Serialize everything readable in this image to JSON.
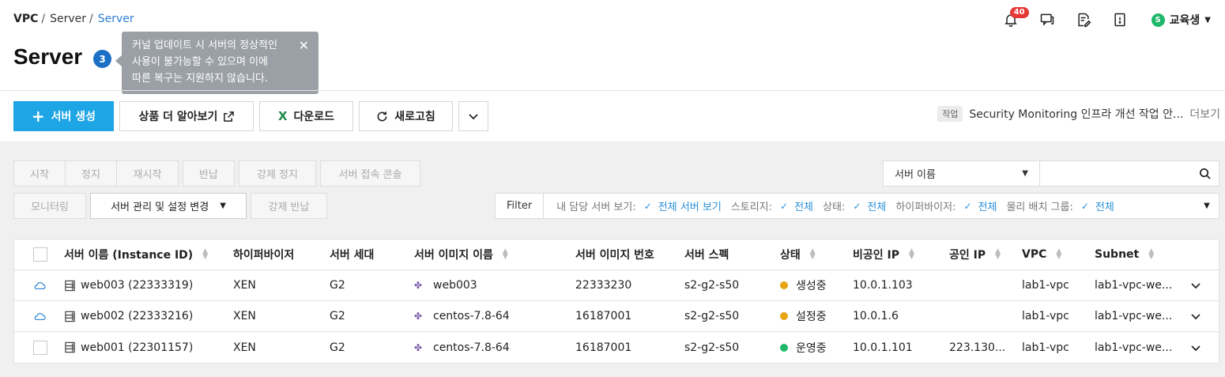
{
  "breadcrumb": {
    "root": "VPC",
    "item": "Server",
    "current": "Server",
    "sep": "/"
  },
  "header": {
    "title": "Server",
    "badge": "3"
  },
  "tooltip": {
    "lines": [
      "커널 업데이트 시 서버의 정상적인",
      "사용이 불가능할 수 있으며 이에",
      "따른 복구는 지원하지 않습니다."
    ],
    "close": "✕"
  },
  "topbar": {
    "notifications": "40",
    "user": "교육생",
    "user_initial": "S"
  },
  "actions": {
    "create": "서버 생성",
    "learn": "상품 더 알아보기",
    "download": "다운로드",
    "refresh": "새로고침"
  },
  "notice": {
    "tag": "작업",
    "text": "Security Monitoring 인프라 개선 작업 안...",
    "more": "더보기"
  },
  "controls": {
    "start": "시작",
    "stop": "정지",
    "restart": "재시작",
    "return": "반납",
    "force_stop": "강제 정지",
    "console": "서버 접속 콘솔",
    "monitoring": "모니터링",
    "manage": "서버 관리 및 설정 변경",
    "force_return": "강제 반납"
  },
  "search": {
    "select": "서버 이름",
    "placeholder": ""
  },
  "filter": {
    "label": "Filter",
    "items": [
      {
        "key": "내 담당 서버 보기:",
        "value": "전체 서버 보기"
      },
      {
        "key": "스토리지:",
        "value": "전체"
      },
      {
        "key": "상태:",
        "value": "전체"
      },
      {
        "key": "하이퍼바이저:",
        "value": "전체"
      },
      {
        "key": "물리 배치 그룹:",
        "value": "전체"
      }
    ]
  },
  "table": {
    "headers": {
      "name": "서버 이름 (Instance ID)",
      "hypervisor": "하이퍼바이저",
      "generation": "서버 세대",
      "image_name": "서버 이미지 이름",
      "image_no": "서버 이미지 번호",
      "spec": "서버 스펙",
      "status": "상태",
      "private_ip": "비공인 IP",
      "public_ip": "공인 IP",
      "vpc": "VPC",
      "subnet": "Subnet"
    },
    "rows": [
      {
        "name": "web003 (22333319)",
        "hypervisor": "XEN",
        "generation": "G2",
        "image_name": "web003",
        "image_no": "22333230",
        "spec": "s2-g2-s50",
        "status": "생성중",
        "status_color": "#e8a317",
        "private_ip": "10.0.1.103",
        "public_ip": "",
        "vpc": "lab1-vpc",
        "subnet": "lab1-vpc-we...",
        "select": "cloud-icon"
      },
      {
        "name": "web002 (22333216)",
        "hypervisor": "XEN",
        "generation": "G2",
        "image_name": "centos-7.8-64",
        "image_no": "16187001",
        "spec": "s2-g2-s50",
        "status": "설정중",
        "status_color": "#e8a317",
        "private_ip": "10.0.1.6",
        "public_ip": "",
        "vpc": "lab1-vpc",
        "subnet": "lab1-vpc-we...",
        "select": "cloud-icon"
      },
      {
        "name": "web001 (22301157)",
        "hypervisor": "XEN",
        "generation": "G2",
        "image_name": "centos-7.8-64",
        "image_no": "16187001",
        "spec": "s2-g2-s50",
        "status": "운영중",
        "status_color": "#1fb86b",
        "private_ip": "10.0.1.101",
        "public_ip": "223.130...",
        "vpc": "lab1-vpc",
        "subnet": "lab1-vpc-we...",
        "select": "checkbox"
      }
    ]
  }
}
